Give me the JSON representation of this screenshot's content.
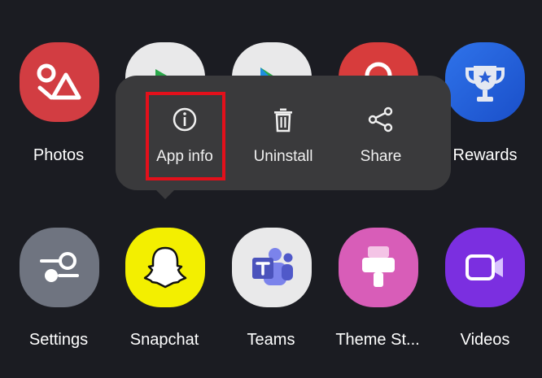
{
  "row1": [
    {
      "name": "Photos"
    },
    {
      "name": ""
    },
    {
      "name": ""
    },
    {
      "name": ""
    },
    {
      "name": "Rewards"
    }
  ],
  "row2": [
    {
      "name": "Settings"
    },
    {
      "name": "Snapchat"
    },
    {
      "name": "Teams"
    },
    {
      "name": "Theme St..."
    },
    {
      "name": "Videos"
    }
  ],
  "popup": {
    "actions": [
      {
        "label": "App info",
        "icon": "info-icon"
      },
      {
        "label": "Uninstall",
        "icon": "trash-icon"
      },
      {
        "label": "Share",
        "icon": "share-icon"
      }
    ]
  },
  "colors": {
    "background": "#1b1c22",
    "popup": "#3a3a3c",
    "highlight": "#e3101b"
  }
}
